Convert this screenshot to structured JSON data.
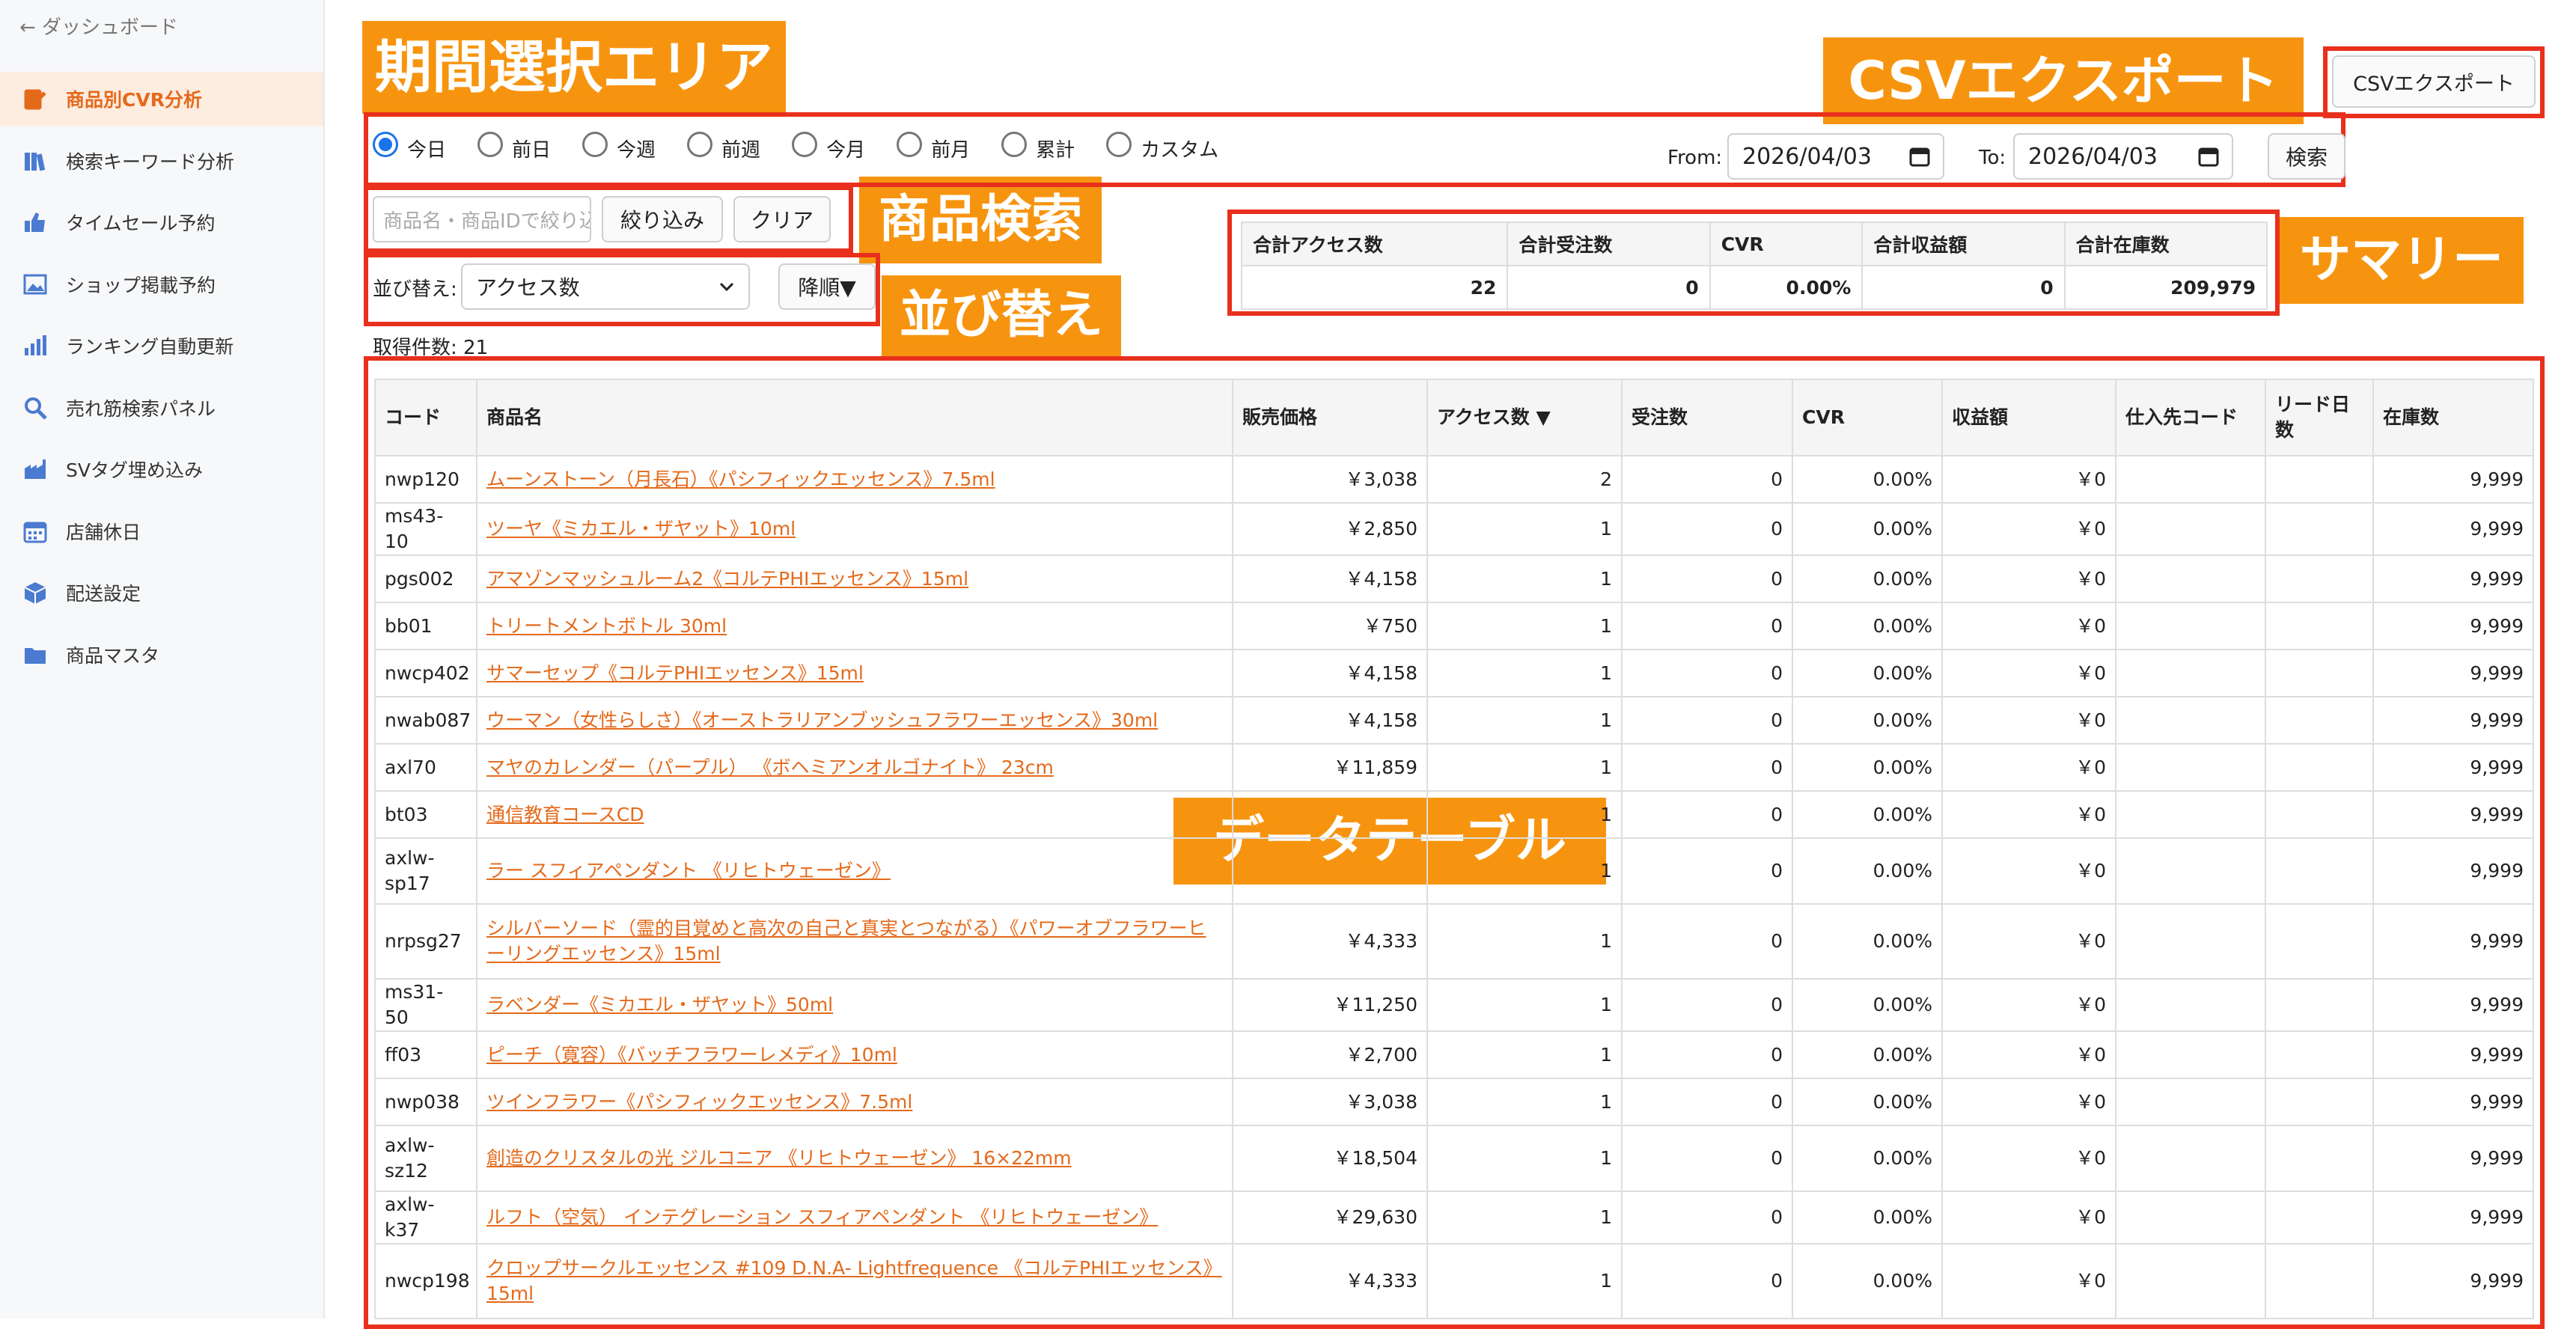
{
  "sidebar": {
    "back": "← ダッシュボード",
    "items": [
      {
        "label": "商品別CVR分析",
        "icon": "edit-icon",
        "active": true
      },
      {
        "label": "検索キーワード分析",
        "icon": "books-icon"
      },
      {
        "label": "タイムセール予約",
        "icon": "thumbs-up-icon"
      },
      {
        "label": "ショップ掲載予約",
        "icon": "image-icon"
      },
      {
        "label": "ランキング自動更新",
        "icon": "bar-chart-icon"
      },
      {
        "label": "売れ筋検索パネル",
        "icon": "search-icon"
      },
      {
        "label": "SVタグ埋め込み",
        "icon": "factory-icon"
      },
      {
        "label": "店舗休日",
        "icon": "calendar-icon"
      },
      {
        "label": "配送設定",
        "icon": "package-icon"
      },
      {
        "label": "商品マスタ",
        "icon": "folder-icon"
      }
    ]
  },
  "callouts": {
    "period": "期間選択エリア",
    "csv": "CSVエクスポート",
    "search": "商品検索",
    "sort": "並び替え",
    "summary": "サマリー",
    "table": "データテーブル"
  },
  "header": {
    "csv_button": "CSVエクスポート"
  },
  "period": {
    "options": [
      "今日",
      "前日",
      "今週",
      "前週",
      "今月",
      "前月",
      "累計",
      "カスタム"
    ],
    "selected": "今日",
    "from_label": "From:",
    "from_value": "2026/04/03",
    "to_label": "To:",
    "to_value": "2026/04/03",
    "search_button": "検索"
  },
  "search": {
    "placeholder": "商品名・商品IDで絞り込",
    "filter_button": "絞り込み",
    "clear_button": "クリア"
  },
  "sort": {
    "label": "並び替え:",
    "value": "アクセス数",
    "order_button": "降順▼"
  },
  "summary": {
    "headers": [
      "合計アクセス数",
      "合計受注数",
      "CVR",
      "合計収益額",
      "合計在庫数"
    ],
    "values": [
      "22",
      "0",
      "0.00%",
      "0",
      "209,979"
    ]
  },
  "result_count": "取得件数: 21",
  "table": {
    "headers": [
      "コード",
      "商品名",
      "販売価格",
      "アクセス数 ▼",
      "受注数",
      "CVR",
      "収益額",
      "仕入先コード",
      "リード日数",
      "在庫数"
    ],
    "rows": [
      {
        "code": "nwp120",
        "name": "ムーンストーン（月長石）《パシフィックエッセンス》7.5ml",
        "price": "￥3,038",
        "access": "2",
        "orders": "0",
        "cvr": "0.00%",
        "revenue": "￥0",
        "supplier": "",
        "lead": "",
        "stock": "9,999"
      },
      {
        "code": "ms43-10",
        "name": "ツーヤ《ミカエル・ザヤット》10ml",
        "price": "￥2,850",
        "access": "1",
        "orders": "0",
        "cvr": "0.00%",
        "revenue": "￥0",
        "supplier": "",
        "lead": "",
        "stock": "9,999"
      },
      {
        "code": "pgs002",
        "name": "アマゾンマッシュルーム2《コルテPHIエッセンス》15ml",
        "price": "￥4,158",
        "access": "1",
        "orders": "0",
        "cvr": "0.00%",
        "revenue": "￥0",
        "supplier": "",
        "lead": "",
        "stock": "9,999"
      },
      {
        "code": "bb01",
        "name": "トリートメントボトル 30ml",
        "price": "￥750",
        "access": "1",
        "orders": "0",
        "cvr": "0.00%",
        "revenue": "￥0",
        "supplier": "",
        "lead": "",
        "stock": "9,999"
      },
      {
        "code": "nwcp402",
        "name": "サマーセップ《コルテPHIエッセンス》15ml",
        "price": "￥4,158",
        "access": "1",
        "orders": "0",
        "cvr": "0.00%",
        "revenue": "￥0",
        "supplier": "",
        "lead": "",
        "stock": "9,999"
      },
      {
        "code": "nwab087",
        "name": "ウーマン（女性らしさ）《オーストラリアンブッシュフラワーエッセンス》30ml",
        "price": "￥4,158",
        "access": "1",
        "orders": "0",
        "cvr": "0.00%",
        "revenue": "￥0",
        "supplier": "",
        "lead": "",
        "stock": "9,999"
      },
      {
        "code": "axl70",
        "name": "マヤのカレンダー（パープル） 《ボヘミアンオルゴナイト》 23cm",
        "price": "￥11,859",
        "access": "1",
        "orders": "0",
        "cvr": "0.00%",
        "revenue": "￥0",
        "supplier": "",
        "lead": "",
        "stock": "9,999"
      },
      {
        "code": "bt03",
        "name": "通信教育コースCD",
        "price": "",
        "access": "1",
        "orders": "0",
        "cvr": "0.00%",
        "revenue": "￥0",
        "supplier": "",
        "lead": "",
        "stock": "9,999"
      },
      {
        "code": "axlw-sp17",
        "name": "ラー スフィアペンダント 《リヒトウェーゼン》",
        "price": "",
        "access": "1",
        "orders": "0",
        "cvr": "0.00%",
        "revenue": "￥0",
        "supplier": "",
        "lead": "",
        "stock": "9,999"
      },
      {
        "code": "nrpsg27",
        "name": "シルバーソード（霊的目覚めと高次の自己と真実とつながる）《パワーオブフラワーヒーリングエッセンス》15ml",
        "price": "￥4,333",
        "access": "1",
        "orders": "0",
        "cvr": "0.00%",
        "revenue": "￥0",
        "supplier": "",
        "lead": "",
        "stock": "9,999"
      },
      {
        "code": "ms31-50",
        "name": "ラベンダー《ミカエル・ザヤット》50ml",
        "price": "￥11,250",
        "access": "1",
        "orders": "0",
        "cvr": "0.00%",
        "revenue": "￥0",
        "supplier": "",
        "lead": "",
        "stock": "9,999"
      },
      {
        "code": "ff03",
        "name": "ピーチ（寛容）《バッチフラワーレメディ》10ml",
        "price": "￥2,700",
        "access": "1",
        "orders": "0",
        "cvr": "0.00%",
        "revenue": "￥0",
        "supplier": "",
        "lead": "",
        "stock": "9,999"
      },
      {
        "code": "nwp038",
        "name": "ツインフラワー《パシフィックエッセンス》7.5ml",
        "price": "￥3,038",
        "access": "1",
        "orders": "0",
        "cvr": "0.00%",
        "revenue": "￥0",
        "supplier": "",
        "lead": "",
        "stock": "9,999"
      },
      {
        "code": "axlw-sz12",
        "name": "創造のクリスタルの光 ジルコニア 《リヒトウェーゼン》 16×22mm",
        "price": "￥18,504",
        "access": "1",
        "orders": "0",
        "cvr": "0.00%",
        "revenue": "￥0",
        "supplier": "",
        "lead": "",
        "stock": "9,999"
      },
      {
        "code": "axlw-k37",
        "name": "ルフト（空気） インテグレーション スフィアペンダント 《リヒトウェーゼン》",
        "price": "￥29,630",
        "access": "1",
        "orders": "0",
        "cvr": "0.00%",
        "revenue": "￥0",
        "supplier": "",
        "lead": "",
        "stock": "9,999"
      },
      {
        "code": "nwcp198",
        "name": "クロップサークルエッセンス #109 D.N.A- Lightfrequence 《コルテPHIエッセンス》15ml",
        "price": "￥4,333",
        "access": "1",
        "orders": "0",
        "cvr": "0.00%",
        "revenue": "￥0",
        "supplier": "",
        "lead": "",
        "stock": "9,999"
      }
    ]
  }
}
